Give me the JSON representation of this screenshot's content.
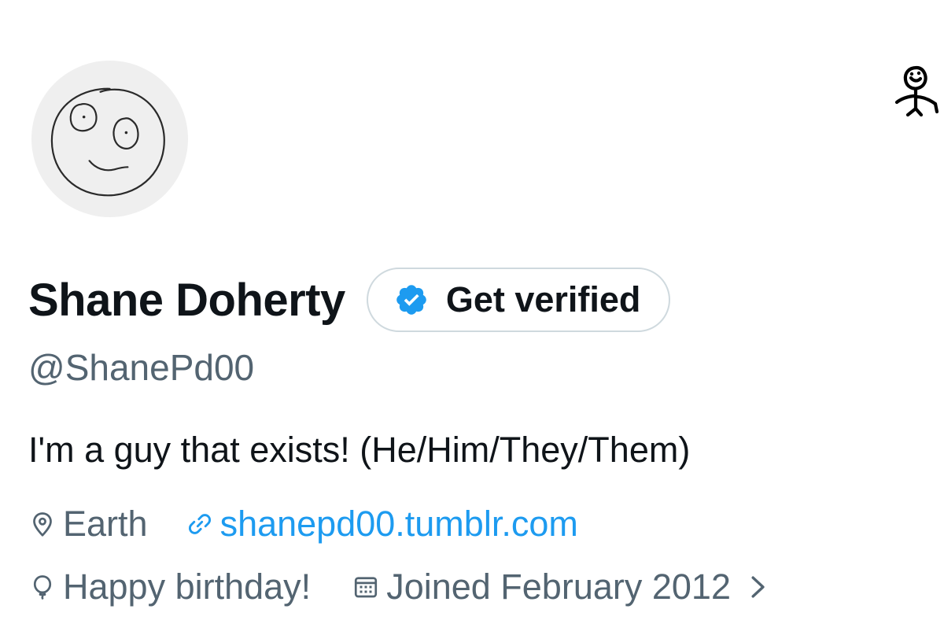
{
  "profile": {
    "display_name": "Shane Doherty",
    "handle": "@ShanePd00",
    "bio": "I'm a guy that exists! (He/Him/They/Them)",
    "avatar_icon": "hand-drawn-smiley-face",
    "corner_icon": "doodle-person-icon"
  },
  "verify_button": {
    "label": "Get verified",
    "icon": "verified-badge-icon",
    "badge_color": "#1d9bf0"
  },
  "meta": {
    "location": {
      "icon": "location-pin-icon",
      "text": "Earth"
    },
    "website": {
      "icon": "link-icon",
      "text": "shanepd00.tumblr.com",
      "color": "#1d9bf0"
    },
    "birthday": {
      "icon": "balloon-icon",
      "text": "Happy birthday!"
    },
    "joined": {
      "icon": "calendar-icon",
      "text": "Joined February 2012",
      "chevron_icon": "chevron-right-icon"
    }
  },
  "colors": {
    "text_primary": "#0f1419",
    "text_secondary": "#536471",
    "accent": "#1d9bf0",
    "border": "#cfd9de",
    "avatar_bg": "#efefef"
  }
}
